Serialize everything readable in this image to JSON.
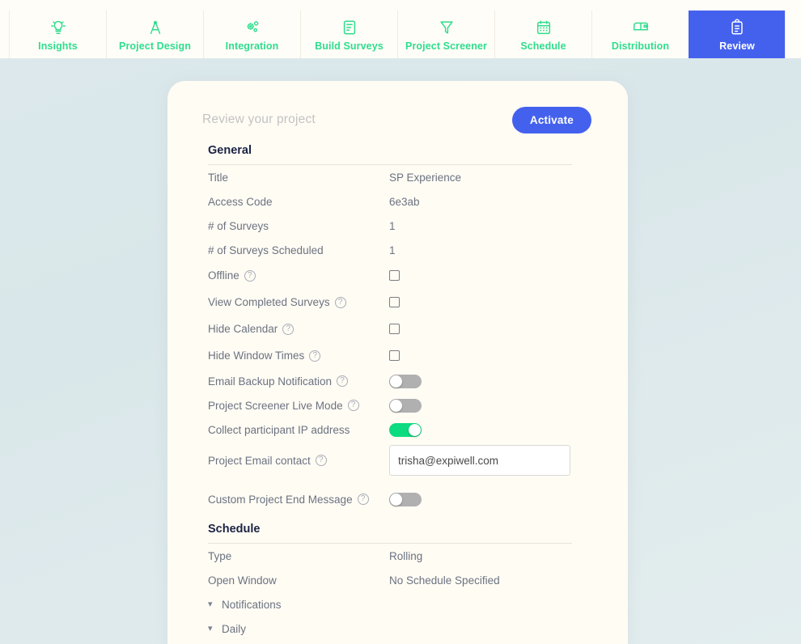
{
  "nav": {
    "items": [
      {
        "label": "Insights",
        "icon": "lightbulb-icon",
        "active": false
      },
      {
        "label": "Project Design",
        "icon": "compass-icon",
        "active": false
      },
      {
        "label": "Integration",
        "icon": "gears-icon",
        "active": false
      },
      {
        "label": "Build Surveys",
        "icon": "document-icon",
        "active": false
      },
      {
        "label": "Project Screener",
        "icon": "funnel-icon",
        "active": false
      },
      {
        "label": "Schedule",
        "icon": "calendar-icon",
        "active": false
      },
      {
        "label": "Distribution",
        "icon": "mailbox-icon",
        "active": false
      },
      {
        "label": "Review",
        "icon": "clipboard-icon",
        "active": true
      }
    ],
    "colors": {
      "accent_green": "#2fdd8e",
      "active_blue": "#4461ee",
      "bar_bg": "#fffdf7"
    }
  },
  "card": {
    "title": "Review your project",
    "activate_label": "Activate",
    "general": {
      "heading": "General",
      "rows": [
        {
          "label": "Title",
          "type": "text",
          "value": "SP Experience",
          "help": false
        },
        {
          "label": "Access Code",
          "type": "text",
          "value": "6e3ab",
          "help": false
        },
        {
          "label": "# of Surveys",
          "type": "text",
          "value": "1",
          "help": false
        },
        {
          "label": "# of Surveys Scheduled",
          "type": "text",
          "value": "1",
          "help": false
        },
        {
          "label": "Offline",
          "type": "checkbox",
          "checked": false,
          "help": true
        },
        {
          "label": "View Completed Surveys",
          "type": "checkbox",
          "checked": false,
          "help": true
        },
        {
          "label": "Hide Calendar",
          "type": "checkbox",
          "checked": false,
          "help": true
        },
        {
          "label": "Hide Window Times",
          "type": "checkbox",
          "checked": false,
          "help": true
        },
        {
          "label": "Email Backup Notification",
          "type": "toggle",
          "on": false,
          "help": true
        },
        {
          "label": "Project Screener Live Mode",
          "type": "toggle",
          "on": false,
          "help": true
        },
        {
          "label": "Collect participant IP address",
          "type": "toggle",
          "on": true,
          "help": false
        },
        {
          "label": "Project Email contact",
          "type": "input",
          "value": "trisha@expiwell.com",
          "placeholder": "",
          "help": true
        },
        {
          "label": "Custom Project End Message",
          "type": "toggle",
          "on": false,
          "help": true
        }
      ]
    },
    "schedule": {
      "heading": "Schedule",
      "rows": [
        {
          "label": "Type",
          "type": "text",
          "value": "Rolling"
        },
        {
          "label": "Open Window",
          "type": "text",
          "value": "No Schedule Specified"
        }
      ],
      "collapsibles": [
        {
          "label": "Notifications",
          "icon": "chevron-down-icon"
        },
        {
          "label": "Daily",
          "icon": "chevron-down-icon"
        }
      ]
    }
  },
  "colors": {
    "page_background": "#dce9ec",
    "card_background": "#fffcf4",
    "toggle_on": "#0ddb7f",
    "toggle_off": "#b0b0b0",
    "label_text": "#6b7280",
    "heading_text": "#1b2344"
  }
}
